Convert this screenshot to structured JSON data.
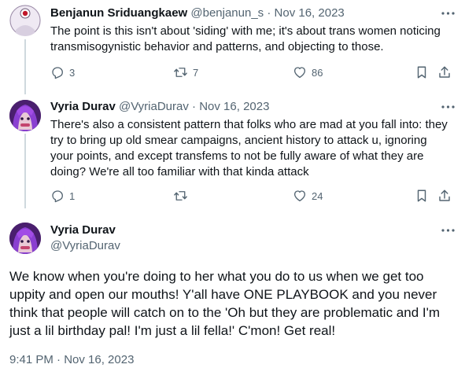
{
  "tweets": [
    {
      "display_name": "Benjanun Sriduangkaew",
      "handle": "@benjanun_s",
      "separator": "·",
      "date": "Nov 16, 2023",
      "text": "The point is this isn't about 'siding' with me; it's about trans women noticing transmisogynistic behavior and patterns, and objecting to those.",
      "replies": "3",
      "retweets": "7",
      "likes": "86"
    },
    {
      "display_name": "Vyria Durav",
      "handle": "@VyriaDurav",
      "separator": "·",
      "date": "Nov 16, 2023",
      "text": "There's also a consistent pattern that folks who are mad at you fall into: they try to bring up old smear campaigns, ancient history to attack u, ignoring your points, and except transfems to not be fully aware of what they are doing? We're all too familiar with that kinda attack",
      "replies": "1",
      "retweets": "",
      "likes": "24"
    }
  ],
  "main_tweet": {
    "display_name": "Vyria Durav",
    "handle": "@VyriaDurav",
    "text": "We know when you're doing to her what you do to us when we get too uppity and open our mouths! Y'all have ONE PLAYBOOK and you never think that people will catch on to the 'Oh but they are problematic and I'm just a lil birthday pal! I'm just a lil fella!' C'mon! Get real!",
    "timestamp": "9:41 PM · Nov 16, 2023"
  },
  "icons": {
    "more": "more-dots-icon",
    "reply": "reply-icon",
    "retweet": "retweet-icon",
    "like": "like-icon",
    "bookmark": "bookmark-icon",
    "share": "share-icon"
  },
  "colors": {
    "text": "#0f1419",
    "secondary": "#536471",
    "thread_line": "#cfd9de",
    "avatar_purple": "#7b2fbe"
  }
}
